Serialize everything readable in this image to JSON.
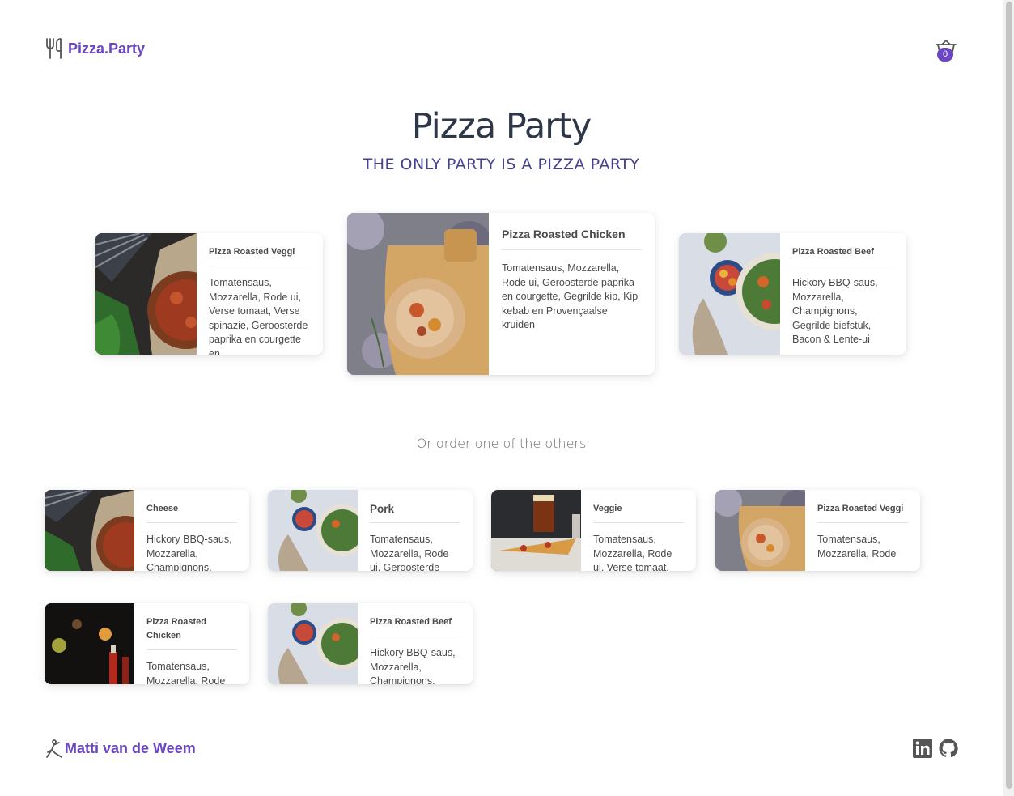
{
  "header": {
    "brand": "Pizza.Party",
    "cart_count": "0"
  },
  "hero": {
    "title": "Pizza Party",
    "tagline": "THE ONLY PARTY IS A PIZZA PARTY"
  },
  "featured": [
    {
      "title": "Pizza Roasted Veggi",
      "description": "Tomatensaus, Mozzarella, Rode ui, Verse tomaat, Verse spinazie, Geroosterde paprika en courgette en"
    },
    {
      "title": "Pizza Roasted Chicken",
      "description": "Tomatensaus, Mozzarella, Rode ui, Geroosterde paprika en courgette, Gegrilde kip, Kip kebab en Provençaalse kruiden"
    },
    {
      "title": "Pizza Roasted Beef",
      "description": "Hickory BBQ-saus, Mozzarella, Champignons, Gegrilde biefstuk, Bacon & Lente-ui"
    }
  ],
  "others_heading": "Or order one of the others",
  "others": [
    {
      "title": "Cheese",
      "description": "Hickory BBQ-saus, Mozzarella, Champignons,"
    },
    {
      "title": "Pork",
      "description": "Tomatensaus, Mozzarella, Rode ui, Geroosterde"
    },
    {
      "title": "Veggie",
      "description": "Tomatensaus, Mozzarella, Rode ui, Verse tomaat,"
    },
    {
      "title": "Pizza Roasted Veggi",
      "description": "Tomatensaus, Mozzarella, Rode"
    },
    {
      "title": "Pizza Roasted Chicken",
      "description": "Tomatensaus, Mozzarella, Rode"
    },
    {
      "title": "Pizza Roasted Beef",
      "description": "Hickory BBQ-saus, Mozzarella, Champignons,"
    }
  ],
  "footer": {
    "author": "Matti van de Weem",
    "social": [
      "linkedin-icon",
      "github-icon"
    ]
  },
  "colors": {
    "accent": "#6b46c1",
    "tagline": "#434190",
    "heading": "#2d3748"
  }
}
